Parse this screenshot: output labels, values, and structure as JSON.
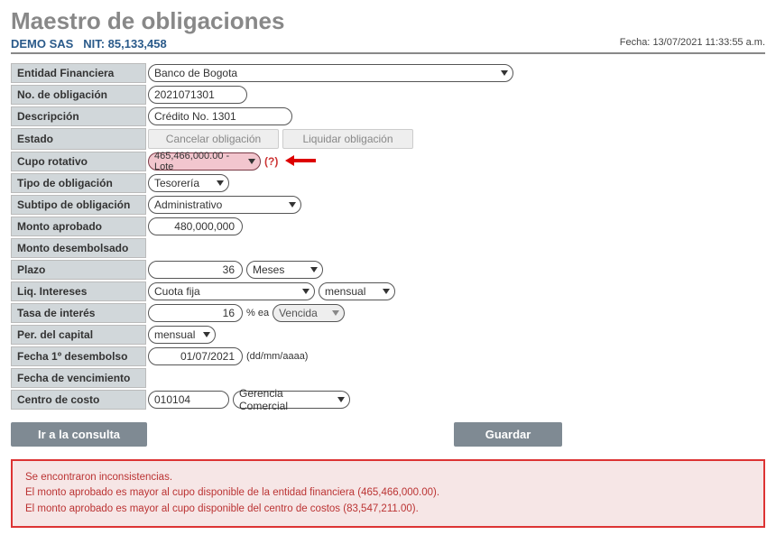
{
  "title": "Maestro de obligaciones",
  "header": {
    "company": "DEMO SAS",
    "nit_label": "NIT:",
    "nit": "85,133,458",
    "fecha_label": "Fecha:",
    "fecha": "13/07/2021 11:33:55 a.m."
  },
  "labels": {
    "entidad": "Entidad Financiera",
    "no_oblig": "No. de obligación",
    "descripcion": "Descripción",
    "estado": "Estado",
    "cupo_rotativo": "Cupo rotativo",
    "tipo_oblig": "Tipo de obligación",
    "subtipo_oblig": "Subtipo de obligación",
    "monto_aprobado": "Monto aprobado",
    "monto_desembolsado": "Monto desembolsado",
    "plazo": "Plazo",
    "liq_intereses": "Liq. Intereses",
    "tasa_interes": "Tasa de interés",
    "per_capital": "Per. del capital",
    "fecha_1_desembolso": "Fecha 1º desembolso",
    "fecha_vencimiento": "Fecha de vencimiento",
    "centro_costo": "Centro de costo"
  },
  "values": {
    "entidad": "Banco de Bogota",
    "no_oblig": "2021071301",
    "descripcion": "Crédito No. 1301",
    "cupo_rotativo": "465,466,000.00 - Lote",
    "tipo_oblig": "Tesorería",
    "subtipo_oblig": "Administrativo",
    "monto_aprobado": "480,000,000",
    "monto_desembolsado": "",
    "plazo_num": "36",
    "plazo_unit": "Meses",
    "liq_tipo": "Cuota fija",
    "liq_periodo": "mensual",
    "tasa_num": "16",
    "tasa_unit": "% ea",
    "tasa_modo": "Vencida",
    "per_capital": "mensual",
    "fecha_1_desembolso": "01/07/2021",
    "fecha_fmt": "(dd/mm/aaaa)",
    "fecha_vencimiento": "",
    "centro_code": "010104",
    "centro_sel": "Gerencia Comercial"
  },
  "buttons": {
    "cancelar": "Cancelar obligación",
    "liquidar": "Liquidar obligación",
    "help": "(?)",
    "ir_consulta": "Ir a la consulta",
    "guardar": "Guardar"
  },
  "messages": {
    "l1": "Se encontraron inconsistencias.",
    "l2": "El monto aprobado es mayor al cupo disponible de la entidad financiera (465,466,000.00).",
    "l3": "El monto aprobado es mayor al cupo disponible del centro de costos (83,547,211.00)."
  }
}
